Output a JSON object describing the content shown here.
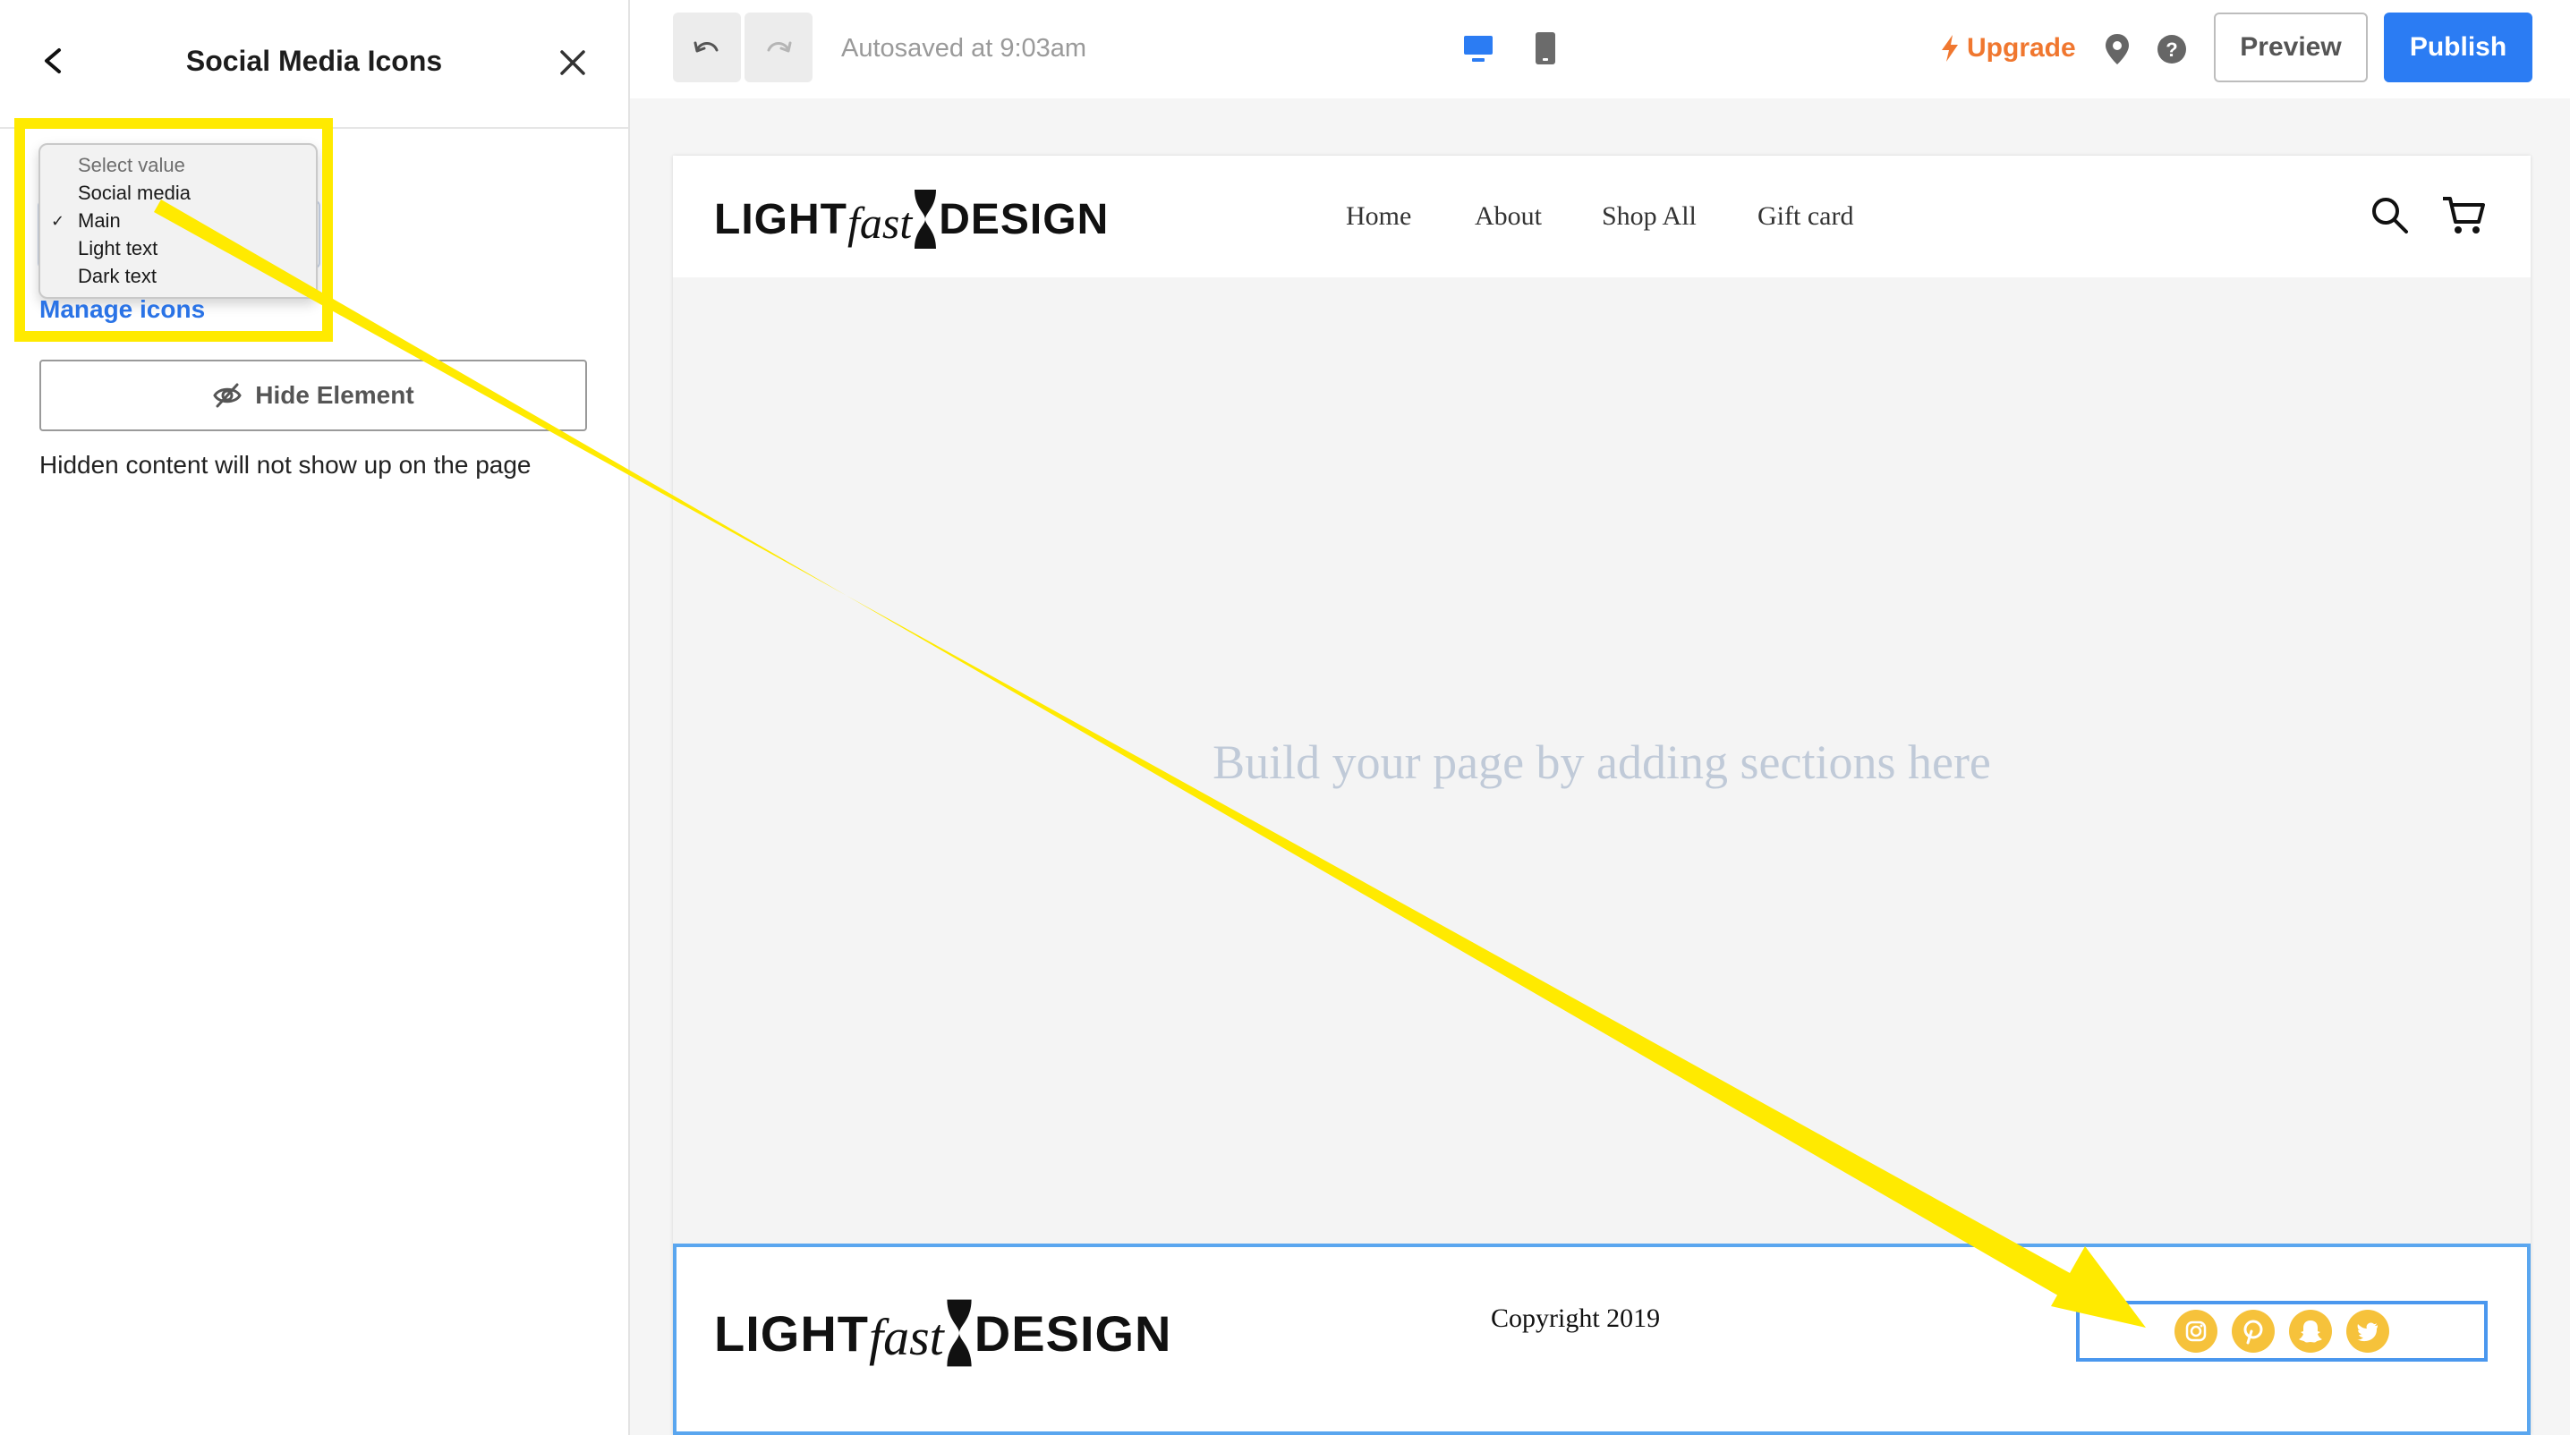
{
  "sidebar": {
    "title": "Social Media Icons",
    "dropdown": {
      "placeholder": "Select value",
      "options": [
        "Social media",
        "Main",
        "Light text",
        "Dark text"
      ],
      "selected": "Main"
    },
    "manage_icons_label": "Manage icons",
    "hide_element_label": "Hide Element",
    "hidden_note": "Hidden content will not show up on the page"
  },
  "toolbar": {
    "autosave_text": "Autosaved at 9:03am",
    "upgrade_label": "Upgrade",
    "preview_label": "Preview",
    "publish_label": "Publish"
  },
  "site": {
    "logo": {
      "part1": "LIGHT",
      "part2": "fast",
      "part3": "DESIGN"
    },
    "nav": [
      "Home",
      "About",
      "Shop All",
      "Gift card"
    ],
    "placeholder_text": "Build your page by adding sections here",
    "footer_copyright": "Copyright 2019",
    "social_icons": [
      "instagram-icon",
      "pinterest-icon",
      "snapchat-icon",
      "twitter-icon"
    ]
  },
  "colors": {
    "accent_blue": "#2b7cf3",
    "link_blue": "#2a73e6",
    "upgrade_orange": "#f0772f",
    "highlight_yellow": "#ffea00",
    "social_icon_yellow": "#f6c23b",
    "selection_blue": "#4a97ee"
  }
}
